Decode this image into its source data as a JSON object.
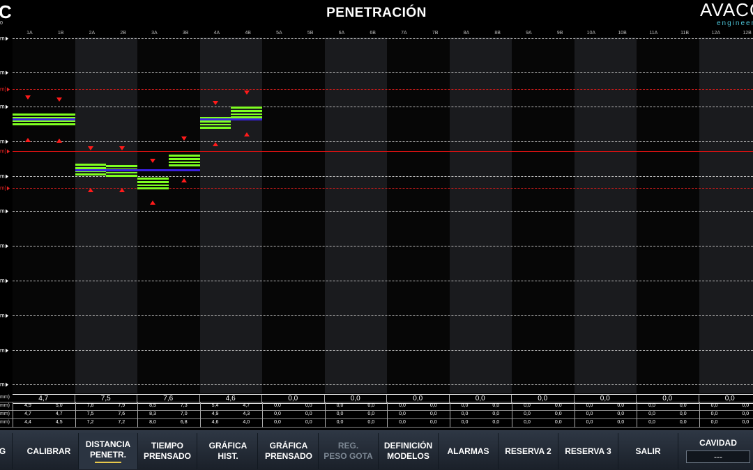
{
  "header": {
    "logo_left": "C",
    "logo_left_sub": "0",
    "title": "PENETRACIÓN",
    "brand_name": "AVACC",
    "brand_tag": "engineer"
  },
  "columns": [
    "1A",
    "1B",
    "2A",
    "2B",
    "3A",
    "3B",
    "4A",
    "4B",
    "5A",
    "5B",
    "6A",
    "6B",
    "7A",
    "7B",
    "8A",
    "8B",
    "9A",
    "9B",
    "10A",
    "10B",
    "11A",
    "11B",
    "12A",
    "12B"
  ],
  "y_axis": {
    "unit_label": "m)",
    "ticks": [
      {
        "label": "m",
        "red": false
      },
      {
        "label": "m",
        "red": false
      },
      {
        "label": "m)",
        "red": true
      },
      {
        "label": "m",
        "red": false
      },
      {
        "label": "m",
        "red": false
      },
      {
        "label": "m)",
        "red": true
      },
      {
        "label": "m",
        "red": false
      },
      {
        "label": "m)",
        "red": true
      },
      {
        "label": "m",
        "red": false
      },
      {
        "label": "m",
        "red": false
      },
      {
        "label": "m",
        "red": false
      },
      {
        "label": "m",
        "red": false
      },
      {
        "label": "m",
        "red": false
      },
      {
        "label": "m",
        "red": false
      }
    ]
  },
  "stats": {
    "row_labels": [
      "mm)",
      "mm)",
      "mm)",
      "mm)"
    ],
    "averages": [
      "4,7",
      "7,5",
      "7,6",
      "4,6",
      "0,0",
      "0,0",
      "0,0",
      "0,0",
      "0,0",
      "0,0",
      "0,0",
      "0,0"
    ],
    "rows": [
      [
        "4,9",
        "5,0",
        "7,8",
        "7,9",
        "8,5",
        "7,3",
        "5,4",
        "4,7",
        "0,0",
        "0,0",
        "0,0",
        "0,0",
        "0,0",
        "0,0",
        "0,0",
        "0,0",
        "0,0",
        "0,0",
        "0,0",
        "0,0",
        "0,0",
        "0,0",
        "0,0",
        "0,0"
      ],
      [
        "4,7",
        "4,7",
        "7,5",
        "7,6",
        "8,3",
        "7,0",
        "4,9",
        "4,3",
        "0,0",
        "0,0",
        "0,0",
        "0,0",
        "0,0",
        "0,0",
        "0,0",
        "0,0",
        "0,0",
        "0,0",
        "0,0",
        "0,0",
        "0,0",
        "0,0",
        "0,0",
        "0,0"
      ],
      [
        "4,4",
        "4,5",
        "7,2",
        "7,2",
        "8,0",
        "6,8",
        "4,6",
        "4,0",
        "0,0",
        "0,0",
        "0,0",
        "0,0",
        "0,0",
        "0,0",
        "0,0",
        "0,0",
        "0,0",
        "0,0",
        "0,0",
        "0,0",
        "0,0",
        "0,0",
        "0,0",
        "0,0"
      ]
    ]
  },
  "nav": {
    "items": [
      {
        "label": "G"
      },
      {
        "label": "CALIBRAR"
      },
      {
        "label": "DISTANCIA\nPENETR.",
        "active": true
      },
      {
        "label": "TIEMPO\nPRENSADO"
      },
      {
        "label": "GRÁFICA\nHIST."
      },
      {
        "label": "GRÁFICA\nPRENSADO"
      },
      {
        "label": "REG.\nPESO GOTA",
        "disabled": true
      },
      {
        "label": "DEFINICIÓN\nMODELOS"
      },
      {
        "label": "ALARMAS"
      },
      {
        "label": "RESERVA 2"
      },
      {
        "label": "RESERVA 3"
      },
      {
        "label": "SALIR"
      }
    ],
    "cavidad_label": "CAVIDAD",
    "cavidad_value": "---"
  },
  "colors": {
    "accent_green": "#7fff21",
    "limit_red": "#ff1a1a",
    "mean_blue": "#3a1fe0",
    "active_underline": "#e8c84b"
  },
  "chart_data": {
    "type": "bar",
    "categories": [
      "1A",
      "1B",
      "2A",
      "2B",
      "3A",
      "3B",
      "4A",
      "4B",
      "5A",
      "5B",
      "6A",
      "6B",
      "7A",
      "7B",
      "8A",
      "8B",
      "9A",
      "9B",
      "10A",
      "10B",
      "11A",
      "11B",
      "12A",
      "12B"
    ],
    "series": [
      {
        "values_max": [
          4.9,
          5.0,
          7.8,
          7.9,
          8.5,
          7.3,
          5.4,
          4.7,
          0,
          0,
          0,
          0,
          0,
          0,
          0,
          0,
          0,
          0,
          0,
          0,
          0,
          0,
          0,
          0
        ]
      },
      {
        "values_avg": [
          4.7,
          4.7,
          7.5,
          7.6,
          8.3,
          7.0,
          4.9,
          4.3,
          0,
          0,
          0,
          0,
          0,
          0,
          0,
          0,
          0,
          0,
          0,
          0,
          0,
          0,
          0,
          0
        ]
      },
      {
        "values_min": [
          4.4,
          4.5,
          7.2,
          7.2,
          8.0,
          6.8,
          4.6,
          4.0,
          0,
          0,
          0,
          0,
          0,
          0,
          0,
          0,
          0,
          0,
          0,
          0,
          0,
          0,
          0,
          0
        ]
      }
    ]
  }
}
